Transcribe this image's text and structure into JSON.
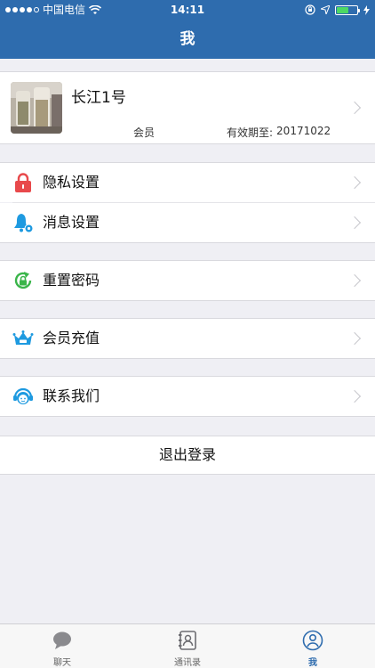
{
  "status_bar": {
    "carrier": "中国电信",
    "time": "14:11"
  },
  "nav": {
    "title": "我"
  },
  "profile": {
    "name": "长江1号",
    "member_label": "会员",
    "validity_label": "有效期至:",
    "validity_value": "20171022"
  },
  "menu": [
    {
      "label": "隐私设置",
      "icon": "lock-icon"
    },
    {
      "label": "消息设置",
      "icon": "bell-settings-icon"
    },
    {
      "label": "重置密码",
      "icon": "reset-lock-icon"
    },
    {
      "label": "会员充值",
      "icon": "vip-crown-icon"
    },
    {
      "label": "联系我们",
      "icon": "customer-service-icon"
    }
  ],
  "logout": {
    "label": "退出登录"
  },
  "tabbar": {
    "tabs": [
      {
        "label": "聊天",
        "icon": "chat-bubble-icon",
        "active": false
      },
      {
        "label": "通讯录",
        "icon": "contacts-book-icon",
        "active": false
      },
      {
        "label": "我",
        "icon": "person-icon",
        "active": true
      }
    ]
  },
  "colors": {
    "nav_bar": "#2e6cae",
    "background": "#efeff4",
    "lock_red": "#e8494b",
    "bell_blue": "#1e9ae0",
    "reset_green": "#3ab54a",
    "vip_blue": "#1e9ae0",
    "battery_green": "#4cd964"
  }
}
